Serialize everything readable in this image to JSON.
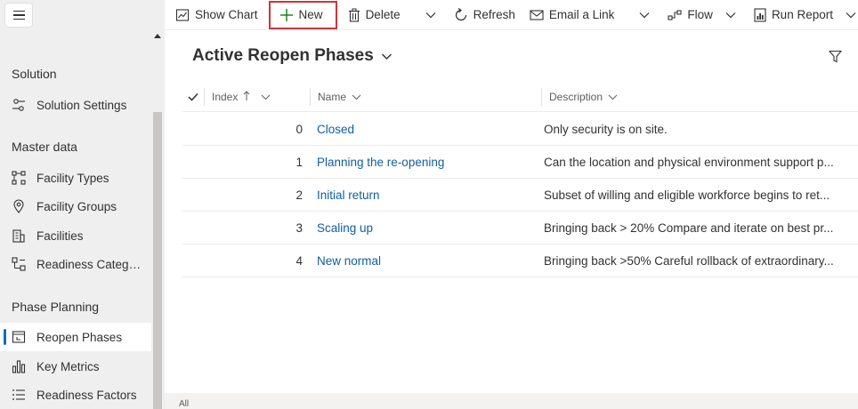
{
  "sidebar": {
    "sections": [
      {
        "title": "Solution",
        "items": [
          {
            "label": "Solution Settings",
            "icon": "settings-sliders-icon"
          }
        ]
      },
      {
        "title": "Master data",
        "items": [
          {
            "label": "Facility Types",
            "icon": "facility-types-icon"
          },
          {
            "label": "Facility Groups",
            "icon": "location-pin-icon"
          },
          {
            "label": "Facilities",
            "icon": "building-icon"
          },
          {
            "label": "Readiness Categor...",
            "icon": "readiness-categories-icon"
          }
        ]
      },
      {
        "title": "Phase Planning",
        "items": [
          {
            "label": "Reopen Phases",
            "icon": "calendar-icon",
            "selected": true
          },
          {
            "label": "Key Metrics",
            "icon": "bar-chart-icon"
          },
          {
            "label": "Readiness Factors",
            "icon": "list-icon"
          }
        ]
      }
    ]
  },
  "toolbar": {
    "show_chart": "Show Chart",
    "new": "New",
    "delete": "Delete",
    "refresh": "Refresh",
    "email_link": "Email a Link",
    "flow": "Flow",
    "run_report": "Run Report",
    "overflow": "E"
  },
  "view": {
    "title": "Active Reopen Phases"
  },
  "grid": {
    "columns": {
      "index": "Index",
      "name": "Name",
      "description": "Description"
    },
    "rows": [
      {
        "index": "0",
        "name": "Closed",
        "description": "Only security is on site."
      },
      {
        "index": "1",
        "name": "Planning the re-opening",
        "description": "Can the location and physical environment support p..."
      },
      {
        "index": "2",
        "name": "Initial return",
        "description": "Subset of willing and eligible workforce begins to ret..."
      },
      {
        "index": "3",
        "name": "Scaling up",
        "description": "Bringing back > 20% Compare and iterate on best pr..."
      },
      {
        "index": "4",
        "name": "New normal",
        "description": "Bringing back >50% Careful rollback of extraordinary..."
      }
    ]
  },
  "footer": {
    "jump_bar": "All"
  },
  "colors": {
    "accent": "#0f6cbd",
    "link": "#115ea3",
    "new_highlight": "#d13438",
    "new_icon": "#107c10"
  }
}
